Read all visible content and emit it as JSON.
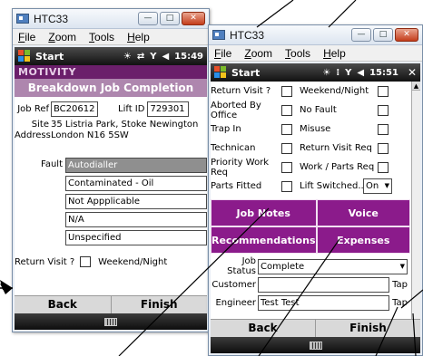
{
  "window1": {
    "title": "HTC33",
    "caption_buttons": [
      "—",
      "□",
      "✕"
    ],
    "menu": [
      "File",
      "Zoom",
      "Tools",
      "Help"
    ],
    "start_label": "Start",
    "time": "15:49",
    "brand": "MOTIVITY",
    "page_title": "Breakdown Job Completion",
    "job_ref_label": "Job Ref",
    "job_ref_value": "BC20612",
    "lift_id_label": "Lift ID",
    "lift_id_value": "729301",
    "site_label": "Site",
    "address_label": "Address",
    "address_line1": "35 Listria Park, Stoke Newington",
    "address_line2": "London  N16 5SW",
    "fault_label": "Fault",
    "fault_values": [
      "Autodialler",
      "Contaminated - Oil",
      "Not Appplicable",
      "N/A",
      "Unspecified"
    ],
    "return_visit_label": "Return Visit ?",
    "weekend_night_label": "Weekend/Night",
    "back_label": "Back",
    "finish_label": "Finish"
  },
  "window2": {
    "title": "HTC33",
    "caption_buttons": [
      "—",
      "□",
      "✕"
    ],
    "menu": [
      "File",
      "Zoom",
      "Tools",
      "Help"
    ],
    "start_label": "Start",
    "time": "15:51",
    "checkbox_rows": [
      {
        "left": "Return Visit ?",
        "right": "Weekend/Night"
      },
      {
        "left": "Aborted By Office",
        "right": "No Fault"
      },
      {
        "left": "Trap In",
        "right": "Misuse"
      },
      {
        "left": "Technican",
        "right": "Return Visit Req"
      },
      {
        "left": "Priority Work Req",
        "right": "Work / Parts Req"
      },
      {
        "left": "Parts Fitted",
        "right": "Lift Switched..."
      }
    ],
    "lift_switched_value": "On",
    "job_notes_label": "Job Notes",
    "voice_label": "Voice",
    "recommendations_label": "Recommendations",
    "expenses_label": "Expenses",
    "job_status_label": "Job Status",
    "job_status_value": "Complete",
    "customer_label": "Customer",
    "customer_value": "",
    "engineer_label": "Engineer",
    "engineer_value": "Test Test",
    "tap_label": "Tap",
    "back_label": "Back",
    "finish_label": "Finish"
  },
  "colors": {
    "brand_purple": "#6b1f6b",
    "header_mauve": "#ae86ae",
    "button_purple": "#8b1b8b",
    "close_red": "#c43d1b"
  }
}
